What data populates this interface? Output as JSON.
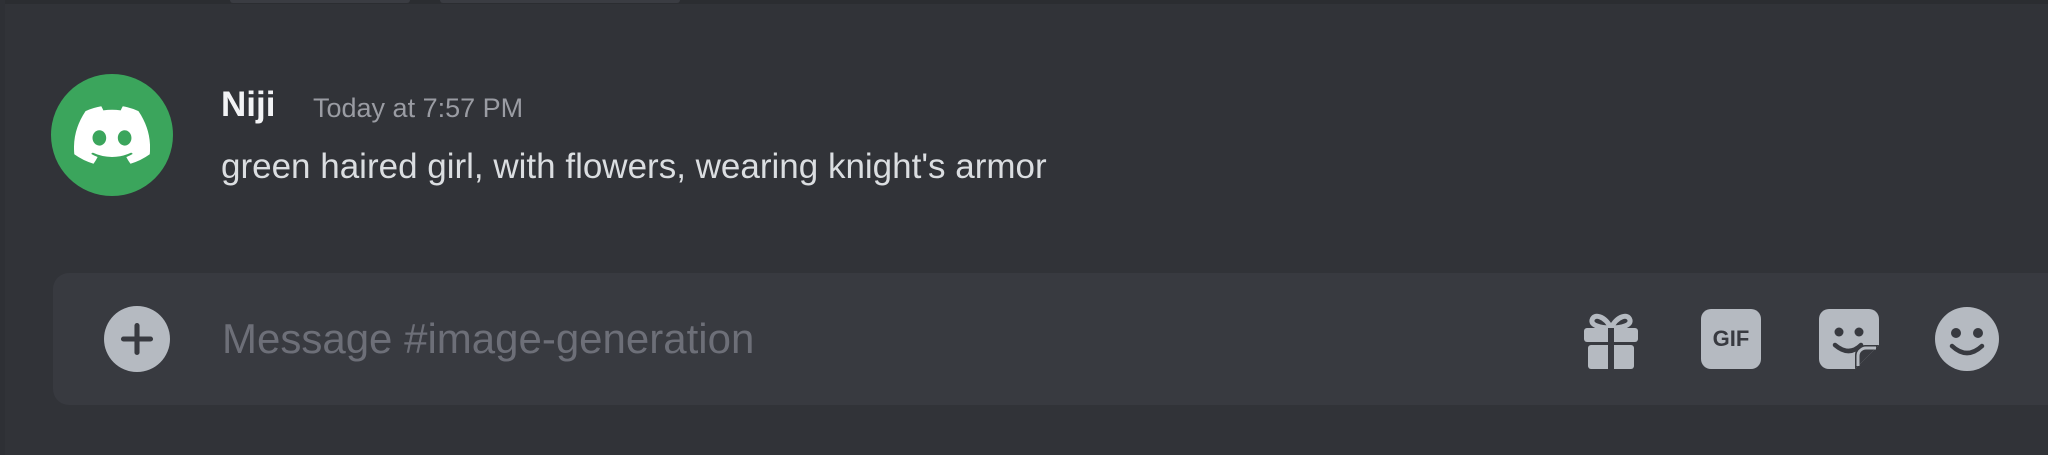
{
  "message": {
    "author": "Niji",
    "timestamp": "Today at 7:57 PM",
    "text": "green haired girl, with flowers, wearing knight's armor",
    "avatar_color": "#3ba55c"
  },
  "composer": {
    "placeholder": "Message #image-generation",
    "gif_label": "GIF"
  },
  "icons": {
    "avatar": "discord-logo-icon",
    "add": "plus-circle-icon",
    "gift": "gift-icon",
    "gif": "gif-icon",
    "sticker": "sticker-icon",
    "emoji": "smiley-emoji-icon"
  },
  "colors": {
    "background": "#313338",
    "composer_background": "#383a40",
    "icon": "#b5bac1",
    "text": "#dbdee1",
    "muted": "#9a9ca3"
  }
}
